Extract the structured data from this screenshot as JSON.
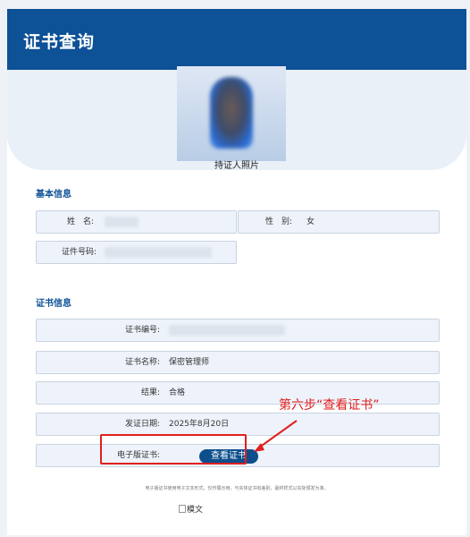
{
  "header": {
    "title": "证书查询"
  },
  "photo": {
    "caption": "持证人照片"
  },
  "basic": {
    "section_title": "基本信息",
    "name_label": "姓　名:",
    "gender_label": "性　别:",
    "gender_value": "女",
    "id_label": "证件号码:"
  },
  "cert": {
    "section_title": "证书信息",
    "number_label": "证书编号:",
    "name_label": "证书名称:",
    "name_value": "保密管理师",
    "result_label": "结果:",
    "result_value": "合格",
    "date_label": "发证日期:",
    "date_value": "2025年8月20日",
    "ecert_label": "电子版证书:",
    "view_button": "查看证书",
    "note": "电子版证书使用电子文本形式，仅作展示用，与实体证书有差别，最终样式以实际颁发为准。"
  },
  "footer": {
    "image_alt": "模文"
  },
  "annotation": {
    "text": "第六步“查看证书”",
    "color": "#e02020"
  },
  "colors": {
    "brand": "#0d5196",
    "field_bg": "#eef3fb",
    "button": "#0d4f8c",
    "annotation": "#e02020"
  }
}
